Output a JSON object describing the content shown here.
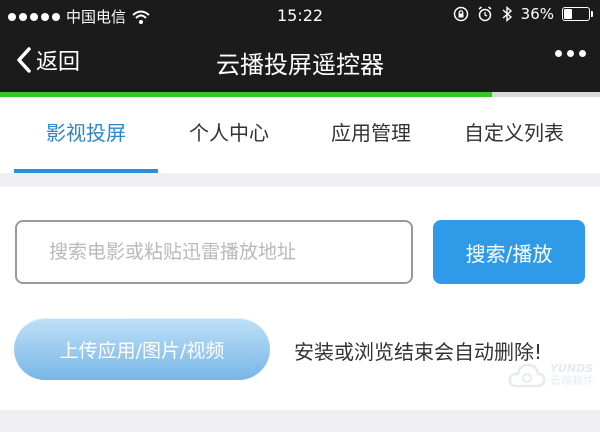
{
  "status_bar": {
    "carrier": "中国电信",
    "time": "15:22",
    "battery_percent": "36%",
    "battery_level": 0.36
  },
  "nav": {
    "back_label": "返回",
    "title": "云播投屏遥控器"
  },
  "page_load_progress": 0.82,
  "tabs": [
    {
      "label": "影视投屏",
      "active": true
    },
    {
      "label": "个人中心",
      "active": false
    },
    {
      "label": "应用管理",
      "active": false
    },
    {
      "label": "自定义列表",
      "active": false
    }
  ],
  "search": {
    "placeholder": "搜索电影或粘贴迅雷播放地址",
    "value": "",
    "button_label": "搜索/播放"
  },
  "upload": {
    "button_label": "上传应用/图片/视频",
    "note": "安装或浏览结束会自动删除!"
  },
  "watermark": {
    "logo_en": "YUNDS",
    "logo_cn": "云端软件"
  },
  "colors": {
    "accent": "#2f9be8",
    "active_tab": "#2a86c7",
    "progress": "#35c42a",
    "nav_bg": "#1b1b1b"
  }
}
